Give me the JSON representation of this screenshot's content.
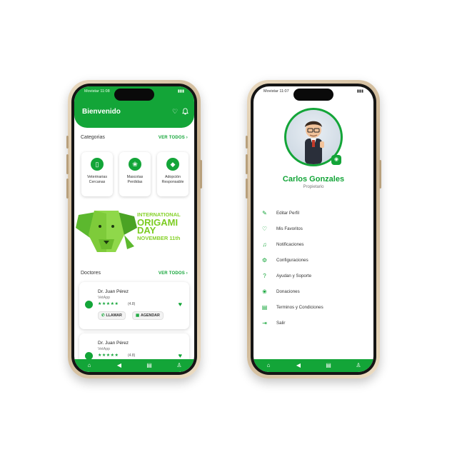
{
  "left_phone": {
    "status": {
      "carrier": "Movistar",
      "time": "11:08"
    },
    "header": {
      "title": "Bienvenido",
      "icons": [
        "heart-outline-icon",
        "bell-icon"
      ]
    },
    "categories": {
      "title": "Categorias",
      "see_all": "VER TODOS",
      "items": [
        {
          "label": "Veterinarias Cercanas",
          "icon": "phone-icon"
        },
        {
          "label": "Mascotas Perdidas",
          "icon": "paw-icon"
        },
        {
          "label": "Adopción Responsable",
          "icon": "shield-icon"
        }
      ]
    },
    "banner": {
      "line1": "INTERNATIONAL",
      "line2": "ORIGAMI",
      "line3": "DAY",
      "line4": "NOVEMBER 11th"
    },
    "doctors": {
      "title": "Doctores",
      "see_all": "VER TODOS",
      "items": [
        {
          "name": "Dr. Juan Pérez",
          "clinic": "VetApp",
          "stars": "★★★★★",
          "rating": "(4.8)",
          "call_label": "LLAMAR",
          "schedule_label": "AGENDAR"
        },
        {
          "name": "Dr. Juan Pérez",
          "clinic": "VetApp",
          "stars": "★★★★★",
          "rating": "(4.8)"
        }
      ]
    },
    "bottom_nav": [
      "home-icon",
      "megaphone-icon",
      "document-icon",
      "profile-icon"
    ]
  },
  "right_phone": {
    "status": {
      "carrier": "Movistar",
      "time": "11:07"
    },
    "profile": {
      "name": "Carlos Gonzales",
      "role": "Propietario"
    },
    "menu": [
      {
        "label": "Editar Perfil",
        "icon": "edit-icon"
      },
      {
        "label": "Mis Favoritos",
        "icon": "heart-icon"
      },
      {
        "label": "Notificaciones",
        "icon": "bell-icon"
      },
      {
        "label": "Configuraciones",
        "icon": "gear-icon"
      },
      {
        "label": "Ayudan y Soporte",
        "icon": "question-icon"
      },
      {
        "label": "Donaciones",
        "icon": "paw-icon"
      },
      {
        "label": "Terminos y Condiciones",
        "icon": "document-icon"
      },
      {
        "label": "Salir",
        "icon": "logout-icon"
      }
    ],
    "bottom_nav": [
      "home-icon",
      "megaphone-icon",
      "document-icon",
      "profile-icon"
    ]
  },
  "colors": {
    "primary": "#13a538",
    "frame": "#d9c4a3"
  }
}
